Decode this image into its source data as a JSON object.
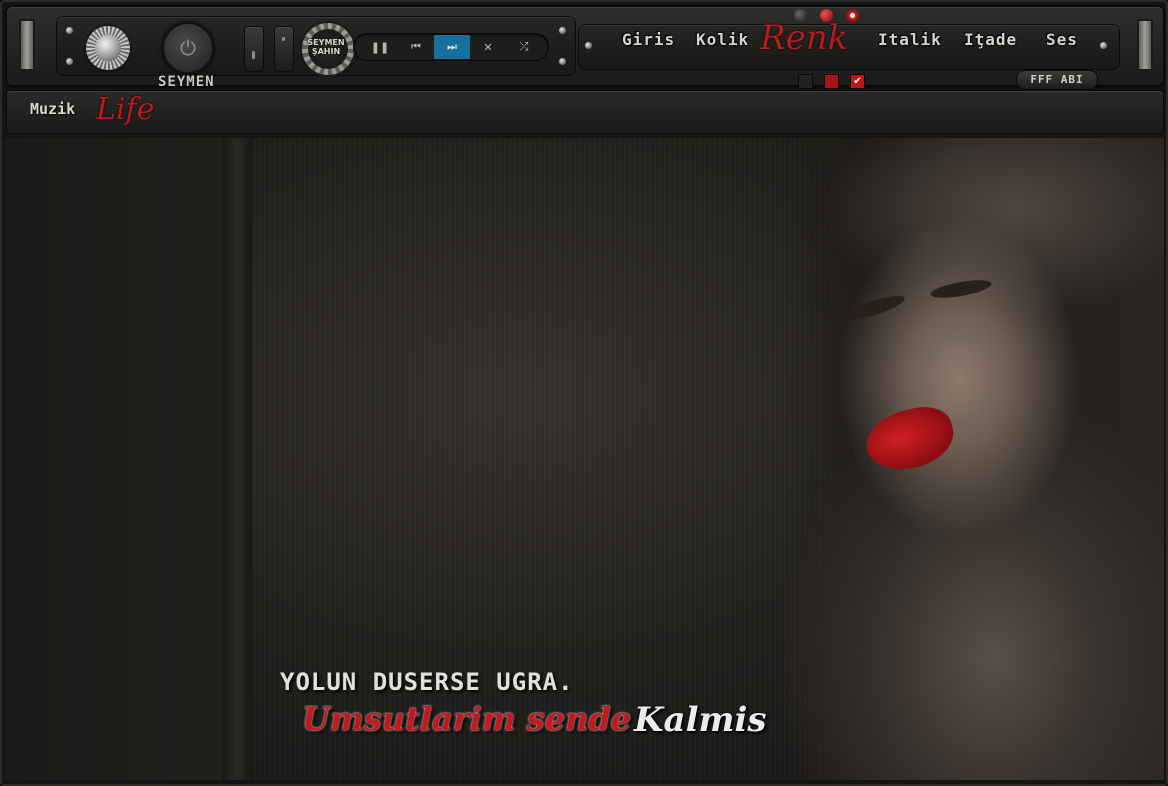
{
  "app": {
    "brand_top": "SEYMEN",
    "logo_text": "SEYMEN ŞAHIN",
    "brand_section": "Muzik",
    "brand_section_script": "Life"
  },
  "controls": {
    "pause_icon": "pause-icon",
    "prev_icon": "previous-icon",
    "next_icon": "next-icon",
    "stop_icon": "close-icon",
    "shuffle_icon": "shuffle-icon",
    "active_control": "next"
  },
  "menu": {
    "items": [
      "Giris",
      "Kolik",
      "Italik",
      "Iţade",
      "Ses"
    ],
    "renk_label": "Renk",
    "fff_button": "FFF ABI"
  },
  "colors": {
    "accent_blue": "#1a6e9e",
    "accent_red": "#c3181d",
    "accent_green": "#2f6f2a",
    "text_light": "#e1e1dc"
  },
  "content": {
    "quote_line1": "YOLUN DUSERSE UGRA.",
    "quote_line2": "Umsutlarim sende",
    "quote_line3": "Kalmis"
  }
}
